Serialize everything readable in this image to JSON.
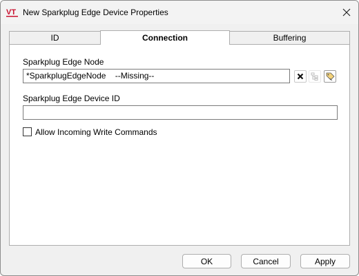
{
  "window": {
    "title": "New Sparkplug Edge Device Properties"
  },
  "logo": {
    "text": "VT"
  },
  "tabs": [
    {
      "label": "ID",
      "active": false
    },
    {
      "label": "Connection",
      "active": true
    },
    {
      "label": "Buffering",
      "active": false
    }
  ],
  "connection": {
    "edge_node_label": "Sparkplug Edge Node",
    "edge_node_value": "*SparkplugEdgeNode    --Missing--",
    "device_id_label": "Sparkplug Edge Device ID",
    "device_id_value": "",
    "allow_write_label": "Allow Incoming Write Commands",
    "allow_write_checked": false
  },
  "buttons": {
    "ok": "OK",
    "cancel": "Cancel",
    "apply": "Apply"
  },
  "colors": {
    "logo_red": "#c8102e",
    "accent_gold": "#d4a017"
  }
}
